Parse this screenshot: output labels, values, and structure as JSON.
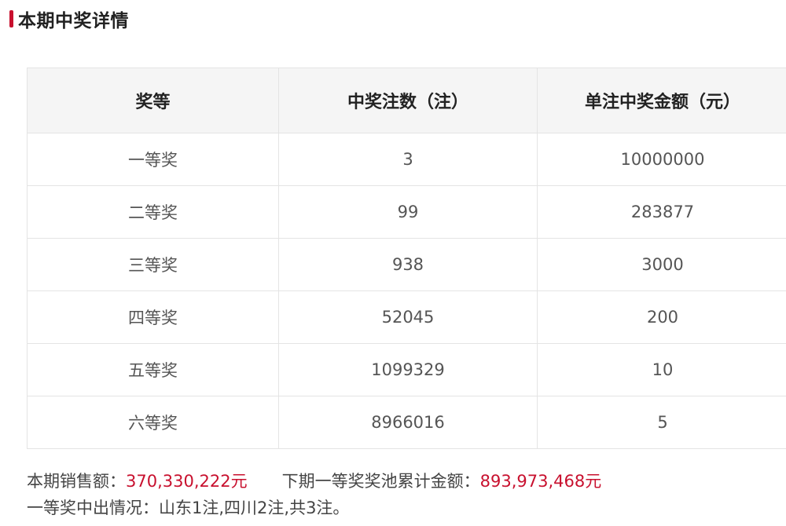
{
  "section": {
    "title": "本期中奖详情",
    "accent_color": "#c8102e"
  },
  "table": {
    "headers": [
      "奖等",
      "中奖注数（注）",
      "单注中奖金额（元）"
    ],
    "rows": [
      {
        "level": "一等奖",
        "count": "3",
        "amount": "10000000"
      },
      {
        "level": "二等奖",
        "count": "99",
        "amount": "283877"
      },
      {
        "level": "三等奖",
        "count": "938",
        "amount": "3000"
      },
      {
        "level": "四等奖",
        "count": "52045",
        "amount": "200"
      },
      {
        "level": "五等奖",
        "count": "1099329",
        "amount": "10"
      },
      {
        "level": "六等奖",
        "count": "8966016",
        "amount": "5"
      }
    ]
  },
  "summary": {
    "sales_label": "本期销售额：",
    "sales_value": "370,330,222元",
    "pool_label": "下期一等奖奖池累计金额：",
    "pool_value": "893,973,468元",
    "winners_line": "一等奖中出情况：山东1注,四川2注,共3注。"
  }
}
